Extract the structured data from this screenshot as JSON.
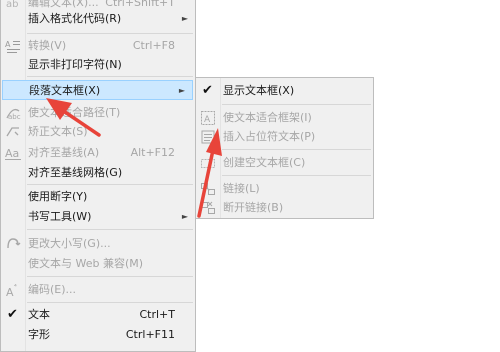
{
  "main_menu": {
    "items": [
      {
        "label": "编辑文本(X)...",
        "shortcut": "Ctrl+Shift+T"
      },
      {
        "label": "插入格式化代码(R)"
      },
      {
        "label": "转换(V)",
        "shortcut": "Ctrl+F8"
      },
      {
        "label": "显示非打印字符(N)"
      },
      {
        "label": "段落文本框(X)"
      },
      {
        "label": "使文本适合路径(T)"
      },
      {
        "label": "矫正文本(S)"
      },
      {
        "label": "对齐至基线(A)",
        "shortcut": "Alt+F12"
      },
      {
        "label": "对齐至基线网格(G)"
      },
      {
        "label": "使用断字(Y)"
      },
      {
        "label": "书写工具(W)"
      },
      {
        "label": "更改大小写(G)..."
      },
      {
        "label": "使文本与 Web 兼容(M)"
      },
      {
        "label": "编码(E)..."
      },
      {
        "label": "文本",
        "shortcut": "Ctrl+T"
      },
      {
        "label": "字形",
        "shortcut": "Ctrl+F11"
      }
    ]
  },
  "sub_menu": {
    "items": [
      {
        "label": "显示文本框(X)"
      },
      {
        "label": "使文本适合框架(I)"
      },
      {
        "label": "插入占位符文本(P)"
      },
      {
        "label": "创建空文本框(C)"
      },
      {
        "label": "链接(L)"
      },
      {
        "label": "断开链接(B)"
      }
    ]
  },
  "icons": {
    "check": "✔",
    "submenu_arrow": "►"
  },
  "colors": {
    "highlight": "#cce8ff",
    "annotation_arrow": "#e8443a"
  }
}
